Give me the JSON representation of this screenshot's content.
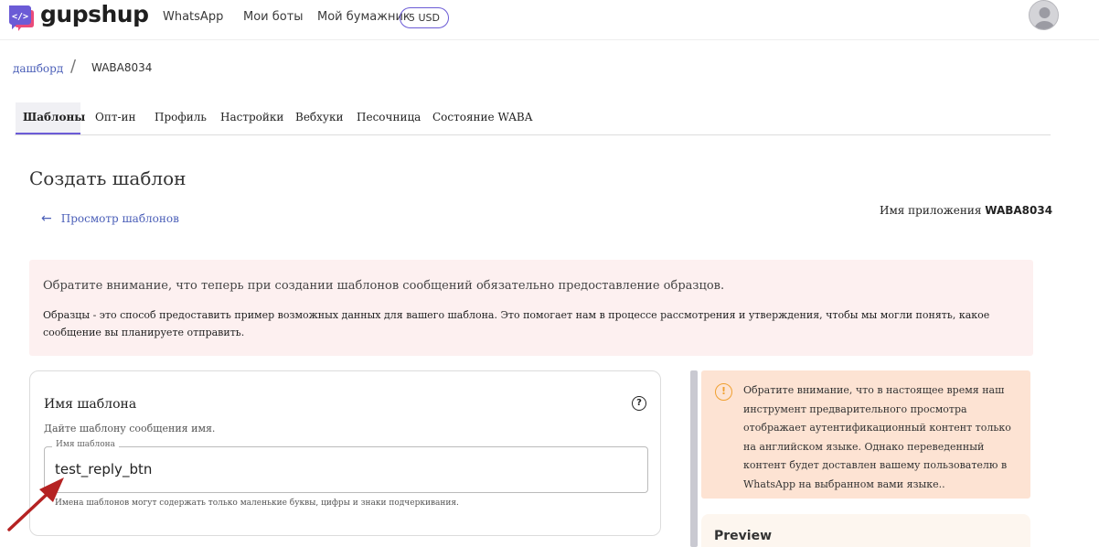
{
  "header": {
    "brand": "gupshup",
    "nav": [
      "WhatsApp",
      "Мои боты",
      "Мой бумажник"
    ],
    "wallet_balance": "5 USD"
  },
  "breadcrumb": {
    "home": "дашборд",
    "separator": "/",
    "current": "WABA8034"
  },
  "tabs": [
    "Шаблоны",
    "Опт-ин",
    "Профиль",
    "Настройки",
    "Вебхуки",
    "Песочница",
    "Состояние WABA"
  ],
  "active_tab": "Шаблоны",
  "page": {
    "title": "Создать шаблон",
    "back_label": "Просмотр шаблонов",
    "app_name_label": "Имя приложения",
    "app_name": "WABA8034"
  },
  "notice": {
    "line1": "Обратите внимание, что теперь при создании шаблонов сообщений обязательно предоставление образцов.",
    "line2": "Образцы - это способ предоставить пример возможных данных для вашего шаблона. Это помогает нам в процессе рассмотрения и утверждения, чтобы мы могли понять, какое сообщение вы планируете отправить."
  },
  "template_card": {
    "title": "Имя шаблона",
    "subtitle": "Дайте шаблону сообщения имя.",
    "field_label": "Имя шаблона",
    "field_value": "test_reply_btn",
    "helper": "Имена шаблонов могут содержать только маленькие буквы, цифры и знаки подчеркивания."
  },
  "warning": {
    "text": "Обратите внимание, что в настоящее время наш инструмент предварительного просмотра отображает аутентификационный контент только на английском языке. Однако переведенный контент будет доставлен вашему пользователю в WhatsApp на выбранном вами языке.."
  },
  "preview": {
    "title": "Preview"
  },
  "colors": {
    "accent": "#6b5bd6",
    "link": "#4b5fb8",
    "notice_bg": "#fdf0f0",
    "warning_bg": "#fde3d3",
    "arrow": "#b52222"
  }
}
